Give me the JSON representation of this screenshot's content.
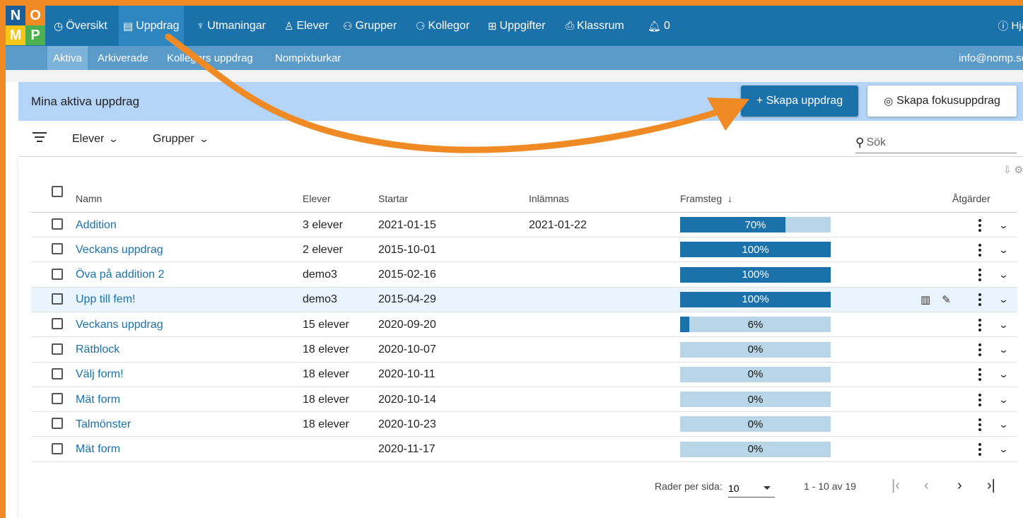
{
  "logo": {
    "letters": [
      "N",
      "O",
      "M",
      "P"
    ]
  },
  "nav": {
    "items": [
      {
        "label": "Översikt",
        "icon": "dashboard-icon",
        "glyph": "◷"
      },
      {
        "label": "Uppdrag",
        "icon": "document-icon",
        "glyph": "▤"
      },
      {
        "label": "Utmaningar",
        "icon": "trophy-icon",
        "glyph": "♆"
      },
      {
        "label": "Elever",
        "icon": "person-icon",
        "glyph": "♙"
      },
      {
        "label": "Grupper",
        "icon": "group-icon",
        "glyph": "⚇"
      },
      {
        "label": "Kollegor",
        "icon": "colleagues-icon",
        "glyph": "⚆"
      },
      {
        "label": "Uppgifter",
        "icon": "grid-icon",
        "glyph": "⊞"
      },
      {
        "label": "Klassrum",
        "icon": "classroom-icon",
        "glyph": "⎙"
      }
    ],
    "notifications": "0",
    "help": "Hjä"
  },
  "subnav": {
    "items": [
      "Aktiva",
      "Arkiverade",
      "Kollegors uppdrag",
      "Nompixburkar"
    ],
    "email": "info@nomp.se"
  },
  "header": {
    "title": "Mina aktiva uppdrag",
    "create_button": "+ Skapa uppdrag",
    "focus_button": "Skapa fokusuppdrag"
  },
  "filters": {
    "students": "Elever",
    "groups": "Grupper",
    "search_placeholder": "Sök"
  },
  "table": {
    "columns": {
      "name": "Namn",
      "students": "Elever",
      "starts": "Startar",
      "due": "Inlämnas",
      "progress": "Framsteg",
      "actions": "Åtgärder"
    },
    "rows": [
      {
        "name": "Addition",
        "students": "3 elever",
        "starts": "2021-01-15",
        "due": "2021-01-22",
        "progress": 70,
        "progress_label": "70%"
      },
      {
        "name": "Veckans uppdrag",
        "students": "2 elever",
        "starts": "2015-10-01",
        "due": "",
        "progress": 100,
        "progress_label": "100%"
      },
      {
        "name": "Öva på addition 2",
        "students": "demo3",
        "starts": "2015-02-16",
        "due": "",
        "progress": 100,
        "progress_label": "100%"
      },
      {
        "name": "Upp till fem!",
        "students": "demo3",
        "starts": "2015-04-29",
        "due": "",
        "progress": 100,
        "progress_label": "100%"
      },
      {
        "name": "Veckans uppdrag",
        "students": "15 elever",
        "starts": "2020-09-20",
        "due": "",
        "progress": 6,
        "progress_label": "6%"
      },
      {
        "name": "Rätblock",
        "students": "18 elever",
        "starts": "2020-10-07",
        "due": "",
        "progress": 0,
        "progress_label": "0%"
      },
      {
        "name": "Välj form!",
        "students": "18 elever",
        "starts": "2020-10-11",
        "due": "",
        "progress": 0,
        "progress_label": "0%"
      },
      {
        "name": "Mät form",
        "students": "18 elever",
        "starts": "2020-10-14",
        "due": "",
        "progress": 0,
        "progress_label": "0%"
      },
      {
        "name": "Talmönster",
        "students": "18 elever",
        "starts": "2020-10-23",
        "due": "",
        "progress": 0,
        "progress_label": "0%"
      },
      {
        "name": "Mät form",
        "students": "",
        "starts": "2020-11-17",
        "due": "",
        "progress": 0,
        "progress_label": "0%"
      }
    ]
  },
  "pagination": {
    "rows_per_page_label": "Rader per sida:",
    "rows_per_page": "10",
    "range": "1 - 10 av 19"
  },
  "colors": {
    "nav": "#1b72ab",
    "accent_arrow": "#f08a24",
    "header_bar": "#b4d5f7",
    "progress_fill": "#1b72ab",
    "progress_track": "#b9d6e8"
  }
}
